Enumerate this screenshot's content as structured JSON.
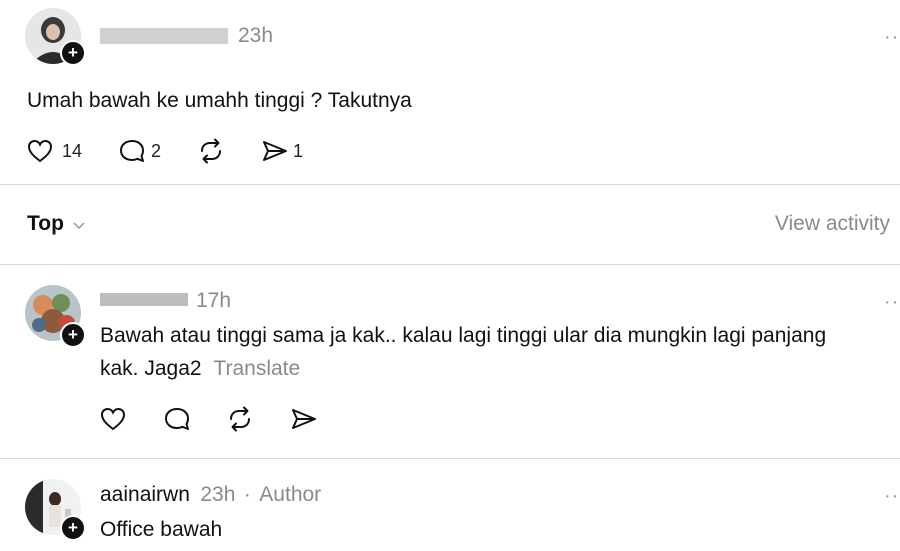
{
  "post": {
    "time": "23h",
    "text": "Umah bawah ke umahh tinggi ? Takutnya",
    "likes": "14",
    "comments": "2",
    "shares": "1"
  },
  "replies_header": {
    "sort_label": "Top",
    "view_activity": "View activity"
  },
  "replies": [
    {
      "time": "17h",
      "text_line1": "Bawah atau tinggi sama ja kak.. kalau lagi tinggi ular dia mungkin lagi panjang",
      "text_line2": "kak. Jaga2",
      "translate": "Translate"
    },
    {
      "username": "aainairwn",
      "time": "23h",
      "separator": "·",
      "badge": "Author",
      "text": "Office bawah"
    }
  ],
  "icons": {
    "like": "heart-icon",
    "comment": "comment-icon",
    "repost": "repost-icon",
    "share": "send-icon",
    "more": "more-dots-icon",
    "follow": "plus-icon",
    "sort": "chevron-down-icon"
  },
  "colors": {
    "text": "#111111",
    "meta": "#8a8a8a",
    "divider": "#d8d8d8",
    "follow_badge": "#111111"
  }
}
